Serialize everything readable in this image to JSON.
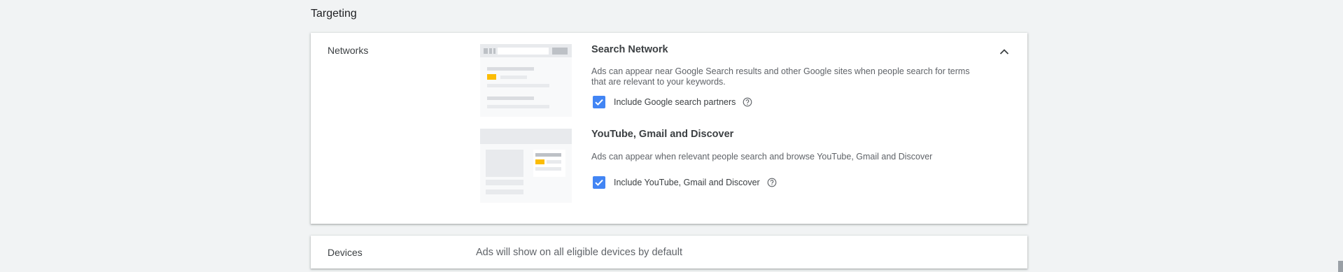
{
  "section": {
    "title": "Targeting"
  },
  "networks": {
    "label": "Networks",
    "search_network": {
      "title": "Search Network",
      "description": "Ads can appear near Google Search results and other Google sites when people search for terms that are relevant to your keywords.",
      "checkbox_label": "Include Google search partners",
      "checked": true
    },
    "youtube_gmail_discover": {
      "title": "YouTube, Gmail and Discover",
      "description": "Ads can appear when relevant people search and browse YouTube, Gmail and Discover",
      "checkbox_label": "Include YouTube, Gmail and Discover",
      "checked": true
    }
  },
  "devices": {
    "label": "Devices",
    "summary": "Ads will show on all eligible devices by default"
  },
  "colors": {
    "accent": "#4285f4",
    "highlight": "#fbbc04",
    "background": "#f1f3f4"
  },
  "icons": {
    "collapse": "chevron-up-icon",
    "help": "help-circle-icon",
    "check": "checkmark-icon"
  }
}
